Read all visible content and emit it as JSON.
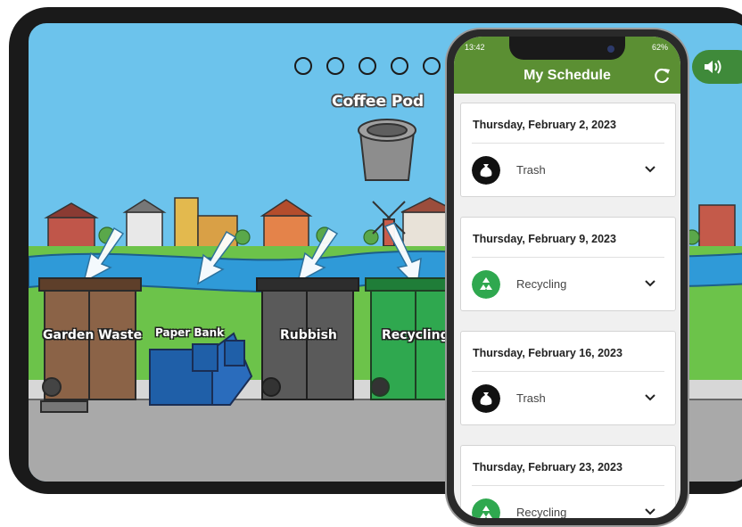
{
  "tablet": {
    "carousel_dots": 5,
    "pod_label": "Coffee Pod",
    "bins": [
      {
        "label": "Garden Waste"
      },
      {
        "label": "Paper Bank"
      },
      {
        "label": "Rubbish"
      },
      {
        "label": "Recycling"
      }
    ],
    "colors": {
      "sky": "#6cc3ec",
      "grass": "#6cc34a",
      "river": "#2f9ad8",
      "brown_bin": "#8b6347",
      "blue_bank": "#1f5fa8",
      "grey_bin": "#5a5a5a",
      "green_bin": "#2fa84f"
    }
  },
  "phone": {
    "status": {
      "time": "13:42",
      "battery": "62%"
    },
    "title": "My Schedule",
    "accent": "#5b8f33",
    "entries": [
      {
        "date": "Thursday, February 2, 2023",
        "type": "Trash",
        "icon": "trash-bag-icon"
      },
      {
        "date": "Thursday, February 9, 2023",
        "type": "Recycling",
        "icon": "recycling-icon"
      },
      {
        "date": "Thursday, February 16, 2023",
        "type": "Trash",
        "icon": "trash-bag-icon"
      },
      {
        "date": "Thursday, February 23, 2023",
        "type": "Recycling",
        "icon": "recycling-icon"
      }
    ]
  }
}
